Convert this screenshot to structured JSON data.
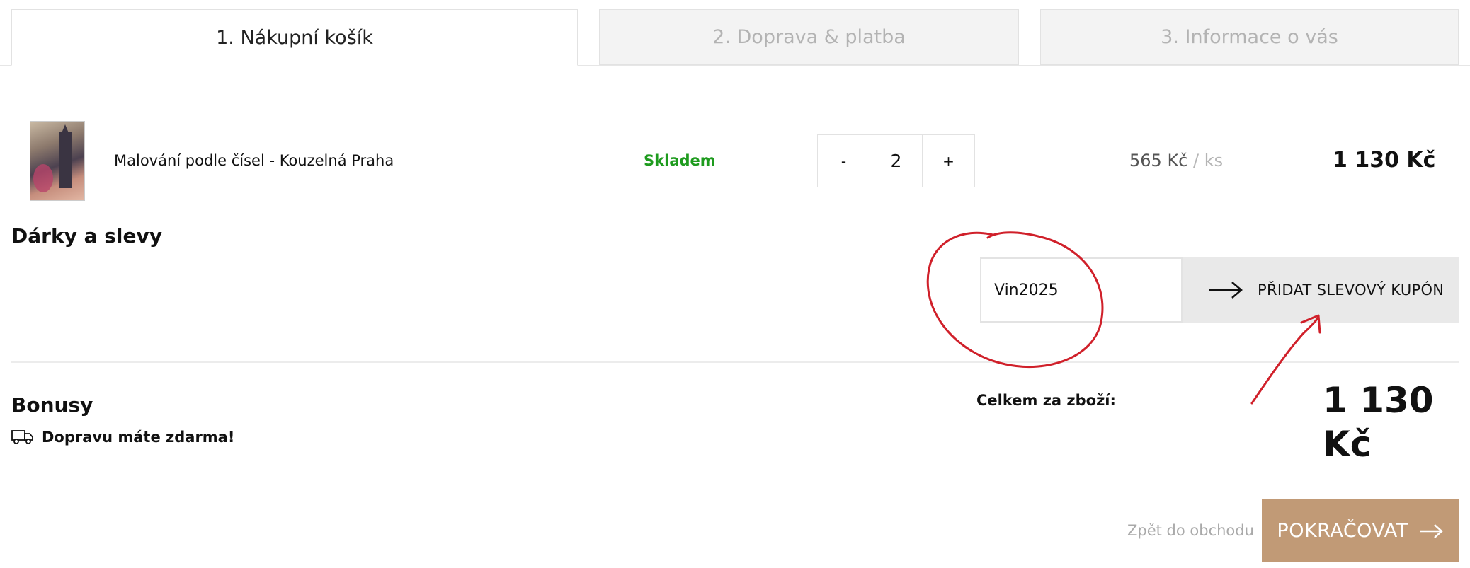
{
  "tabs": [
    {
      "label": "1. Nákupní košík",
      "active": true
    },
    {
      "label": "2. Doprava & platba",
      "active": false
    },
    {
      "label": "3. Informace o vás",
      "active": false
    }
  ],
  "cart": {
    "items": [
      {
        "name": "Malování podle čísel - Kouzelná Praha",
        "availability": "Skladem",
        "quantity": "2",
        "decrement_label": "-",
        "increment_label": "+",
        "unit_price": "565 Kč",
        "unit_suffix": "/ ks",
        "total": "1 130 Kč"
      }
    ]
  },
  "gifts": {
    "title": "Dárky a slevy",
    "coupon_value": "Vin2025",
    "coupon_button_label": "PŘIDAT SLEVOVÝ KUPÓN"
  },
  "bonuses": {
    "title": "Bonusy",
    "free_shipping": "Dopravu máte zdarma!"
  },
  "summary": {
    "total_label": "Celkem za zboží:",
    "total_value": "1 130 Kč"
  },
  "actions": {
    "back_label": "Zpět do obchodu",
    "continue_label": "POKRAČOVAT"
  },
  "colors": {
    "in_stock": "#1e9b1e",
    "continue_button": "#c19a76",
    "annotation": "#d0202a"
  }
}
